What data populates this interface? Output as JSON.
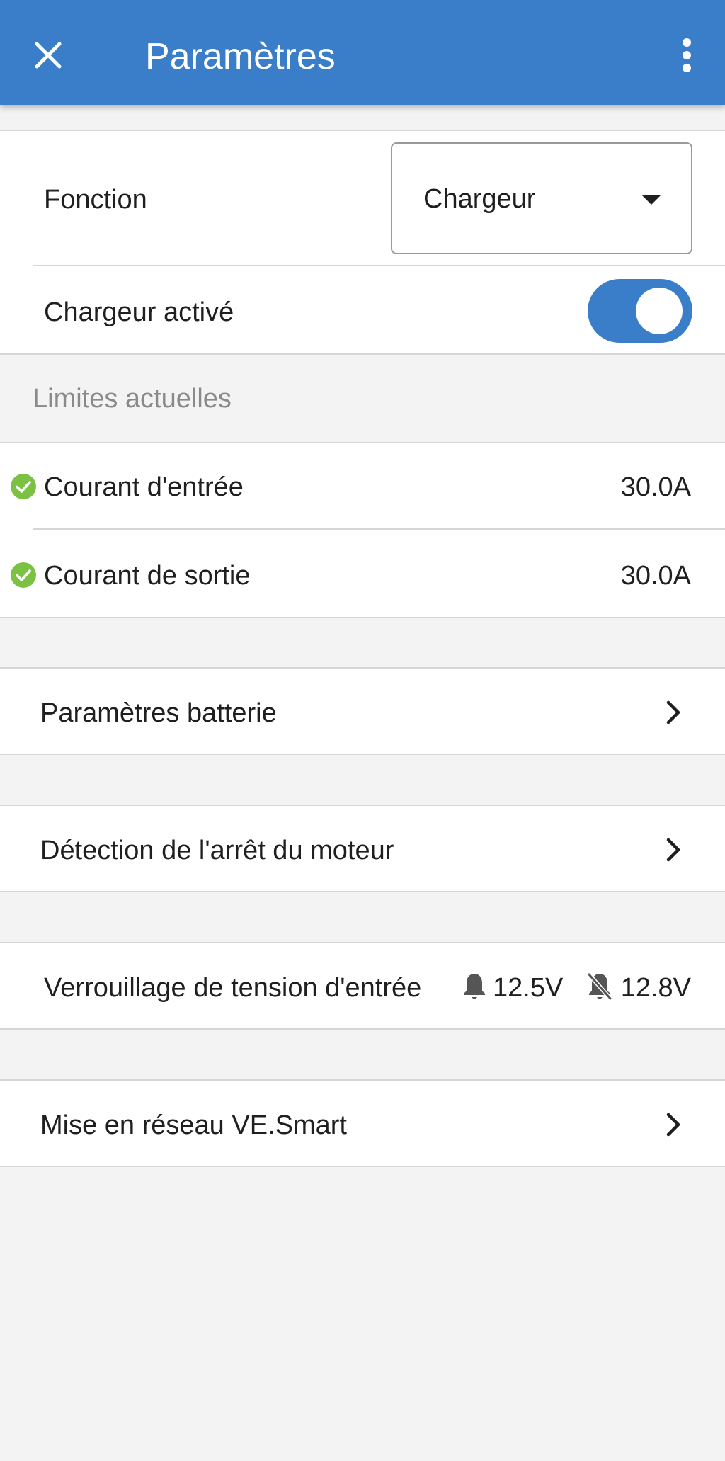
{
  "appbar": {
    "title": "Paramètres",
    "close_icon": "close-icon",
    "menu_icon": "more-vert-icon",
    "color": "#3a7dc9"
  },
  "function_row": {
    "label": "Fonction",
    "selected": "Chargeur"
  },
  "charger_row": {
    "label": "Chargeur activé",
    "enabled": true
  },
  "limits": {
    "header": "Limites actuelles",
    "items": [
      {
        "label": "Courant d'entrée",
        "value": "30.0A",
        "status_icon": "check-circle-icon"
      },
      {
        "label": "Courant de sortie",
        "value": "30.0A",
        "status_icon": "check-circle-icon"
      }
    ]
  },
  "nav": {
    "battery": "Paramètres batterie",
    "engine": "Détection de l'arrêt du moteur",
    "network": "Mise en réseau VE.Smart"
  },
  "lockout": {
    "label": "Verrouillage de tension d'entrée",
    "on_value": "12.5V",
    "off_value": "12.8V",
    "on_icon": "bell-icon",
    "off_icon": "bell-off-icon"
  },
  "colors": {
    "accent": "#3a7dc9",
    "ok": "#7cc242",
    "background": "#f3f3f3"
  }
}
